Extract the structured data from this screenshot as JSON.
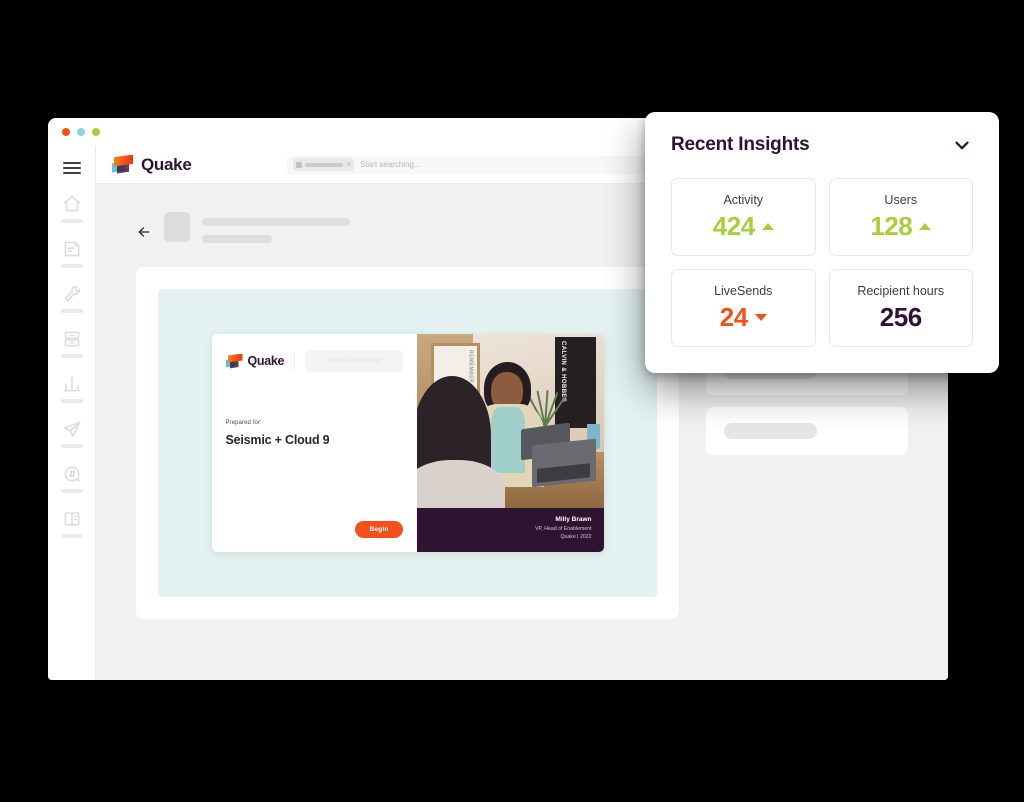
{
  "window": {
    "traffic_lights": [
      "close",
      "minimize",
      "maximize"
    ]
  },
  "sidebar": {
    "menu_icon": "hamburger-menu-icon",
    "items": [
      {
        "icon": "home-icon",
        "name": "home"
      },
      {
        "icon": "document-icon",
        "name": "documents"
      },
      {
        "icon": "wrench-icon",
        "name": "tools"
      },
      {
        "icon": "file-cabinet-icon",
        "name": "library"
      },
      {
        "icon": "bar-chart-icon",
        "name": "analytics"
      },
      {
        "icon": "paper-plane-icon",
        "name": "send"
      },
      {
        "icon": "chat-hash-icon",
        "name": "channels"
      },
      {
        "icon": "book-layout-icon",
        "name": "pages"
      }
    ]
  },
  "appbar": {
    "brand_name": "Quake",
    "brand_icon": "quake-logo-icon"
  },
  "search": {
    "placeholder": "Start searching...",
    "chip_icon": "filter-icon",
    "chip_close": "×"
  },
  "document": {
    "back_icon": "back-arrow-icon"
  },
  "slide": {
    "brand_name": "Quake",
    "logo_placeholder": "Insert Custom Logo",
    "prepared_label": "Prepared for:",
    "title": "Seismic + Cloud 9",
    "begin_label": "Begin",
    "photo_frame_text": "REMEMBER",
    "photo_poster_text": "CALVIN\n& HOBBES",
    "speaker": {
      "name": "Milly Brawn",
      "role": "VP, Head of Enablement",
      "org": "Quake | 2022"
    }
  },
  "insights": {
    "title": "Recent Insights",
    "collapse_icon": "chevron-down-icon",
    "cards": [
      {
        "label": "Activity",
        "value": "424",
        "trend": "up",
        "color": "#A9CE3C"
      },
      {
        "label": "Users",
        "value": "128",
        "trend": "up",
        "color": "#A9CE3C"
      },
      {
        "label": "LiveSends",
        "value": "24",
        "trend": "down",
        "color": "#F2511B"
      },
      {
        "label": "Recipient hours",
        "value": "256",
        "trend": "none",
        "color": "#2E1332"
      }
    ]
  },
  "colors": {
    "brand_purple": "#2E1332",
    "brand_orange": "#F2511B",
    "brand_green": "#A9CE3C",
    "brand_teal": "#5BC8D2",
    "slide_bg": "#E4F3F2"
  }
}
